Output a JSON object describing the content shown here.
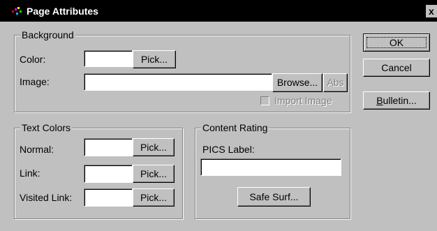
{
  "window": {
    "title": "Page Attributes",
    "close_symbol": "x"
  },
  "background_group": {
    "label": "Background",
    "color_label": "Color:",
    "image_label": "Image:",
    "pick_label": "Pick...",
    "browse_label": "Browse...",
    "abs_label": "Abs",
    "import_image_label": "Import Image",
    "color_value": "",
    "image_value": ""
  },
  "text_colors_group": {
    "label": "Text Colors",
    "normal_label": "Normal:",
    "link_label": "Link:",
    "visited_label": "Visited Link:",
    "pick_label": "Pick..."
  },
  "content_rating_group": {
    "label": "Content Rating",
    "pics_label": "PICS Label:",
    "pics_value": "",
    "safe_surf_label": "Safe Surf..."
  },
  "buttons": {
    "ok": "OK",
    "cancel": "Cancel",
    "bulletin_mnemonic": "B",
    "bulletin_rest": "ulletin..."
  },
  "icons": {
    "app_icon": "page-attributes-icon"
  }
}
